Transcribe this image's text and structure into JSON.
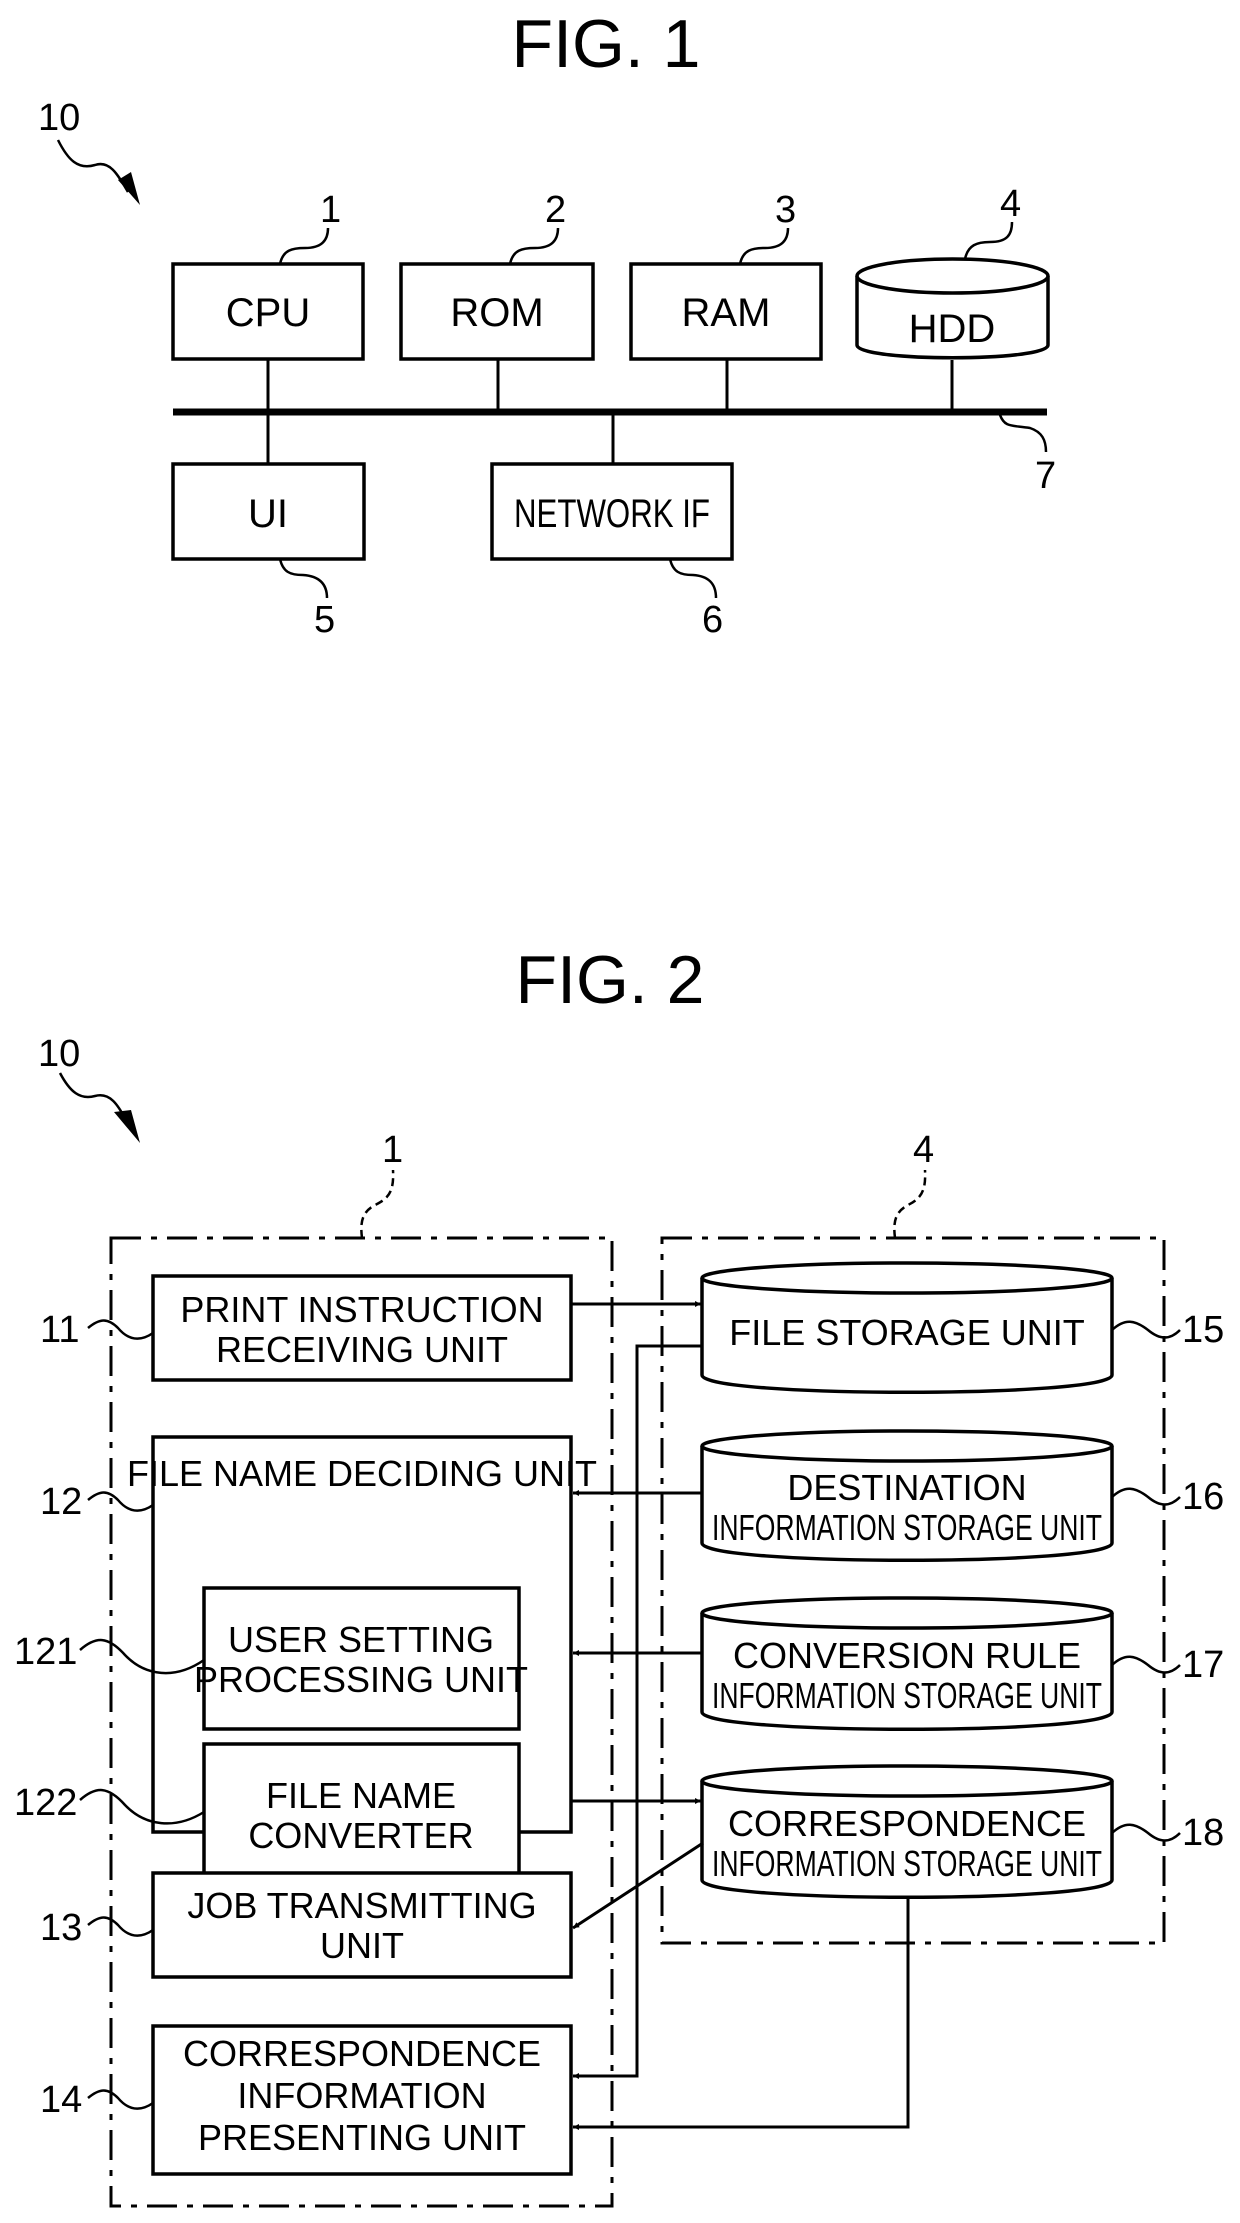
{
  "fig1": {
    "title": "FIG. 1",
    "system_ref": "10",
    "bus_ref": "7",
    "components": {
      "cpu": {
        "label": "CPU",
        "ref": "1"
      },
      "rom": {
        "label": "ROM",
        "ref": "2"
      },
      "ram": {
        "label": "RAM",
        "ref": "3"
      },
      "hdd": {
        "label": "HDD",
        "ref": "4"
      },
      "ui": {
        "label": "UI",
        "ref": "5"
      },
      "network_if": {
        "label": "NETWORK IF",
        "ref": "6"
      }
    }
  },
  "fig2": {
    "title": "FIG. 2",
    "system_ref": "10",
    "cpu_group_ref": "1",
    "hdd_group_ref": "4",
    "units": {
      "print_instruction": {
        "lines": [
          "PRINT INSTRUCTION",
          "RECEIVING UNIT"
        ],
        "ref": "11"
      },
      "file_name_deciding": {
        "lines": [
          "FILE NAME DECIDING UNIT"
        ],
        "ref": "12"
      },
      "user_setting": {
        "lines": [
          "USER SETTING",
          "PROCESSING UNIT"
        ],
        "ref": "121"
      },
      "file_name_converter": {
        "lines": [
          "FILE NAME",
          "CONVERTER"
        ],
        "ref": "122"
      },
      "job_transmitting": {
        "lines": [
          "JOB TRANSMITTING",
          "UNIT"
        ],
        "ref": "13"
      },
      "correspondence_presenting": {
        "lines": [
          "CORRESPONDENCE",
          "INFORMATION",
          "PRESENTING UNIT"
        ],
        "ref": "14"
      }
    },
    "storages": {
      "file_storage": {
        "lines": [
          "FILE STORAGE UNIT"
        ],
        "ref": "15"
      },
      "destination_info": {
        "lines": [
          "DESTINATION",
          "INFORMATION STORAGE UNIT"
        ],
        "ref": "16"
      },
      "conversion_rule": {
        "lines": [
          "CONVERSION RULE",
          "INFORMATION STORAGE UNIT"
        ],
        "ref": "17"
      },
      "correspondence_info": {
        "lines": [
          "CORRESPONDENCE",
          "INFORMATION STORAGE UNIT"
        ],
        "ref": "18"
      }
    }
  }
}
